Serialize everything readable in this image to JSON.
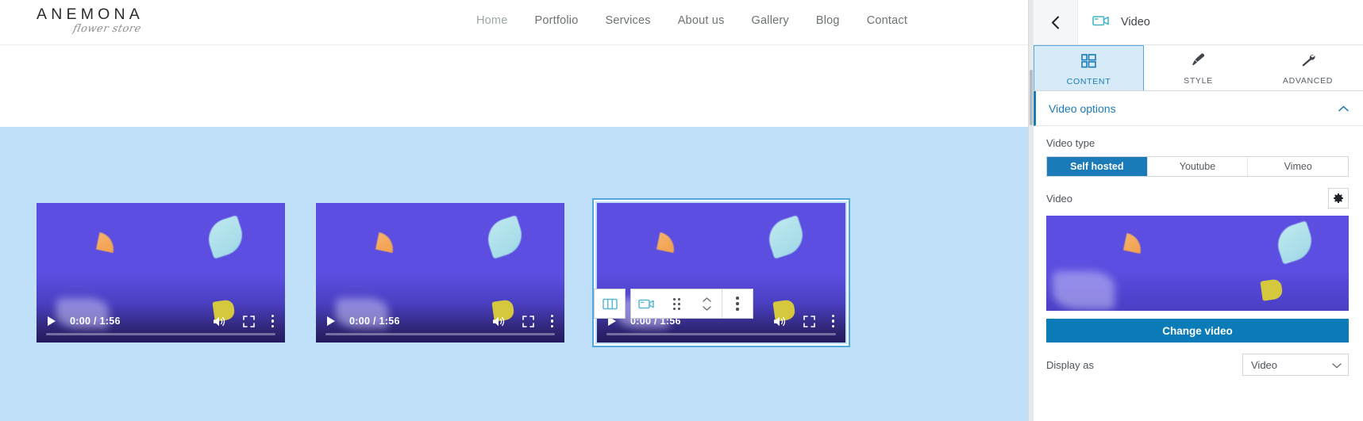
{
  "site": {
    "logo_main": "ANEMONA",
    "logo_sub": "flower store",
    "nav": [
      {
        "label": "Home",
        "active": true
      },
      {
        "label": "Portfolio",
        "active": false
      },
      {
        "label": "Services",
        "active": false
      },
      {
        "label": "About us",
        "active": false
      },
      {
        "label": "Gallery",
        "active": false
      },
      {
        "label": "Blog",
        "active": false
      },
      {
        "label": "Contact",
        "active": false
      }
    ]
  },
  "canvas": {
    "band_color": "#bfe0f8",
    "videos": [
      {
        "name": "video-1",
        "time": "0:00 / 1:56",
        "selected": false
      },
      {
        "name": "video-2",
        "time": "0:00 / 1:56",
        "selected": false
      },
      {
        "name": "video-3",
        "time": "0:00 / 1:56",
        "selected": true
      }
    ]
  },
  "toolbar": {
    "columns_icon": "columns-icon",
    "widget_icon": "video-widget-icon",
    "drag_icon": "drag-handle-icon",
    "reorder_icon": "reorder-arrows-icon",
    "more_icon": "more-options-icon"
  },
  "panel": {
    "back_icon": "chevron-left-icon",
    "header_icon": "video-icon",
    "title": "Video",
    "tabs": [
      {
        "label": "CONTENT",
        "icon": "layout-icon",
        "active": true
      },
      {
        "label": "STYLE",
        "icon": "brush-icon",
        "active": false
      },
      {
        "label": "ADVANCED",
        "icon": "wrench-icon",
        "active": false
      }
    ],
    "section": {
      "title": "Video options",
      "collapse_icon": "chevron-up-icon",
      "expanded": true
    },
    "video_type": {
      "label": "Video type",
      "options": [
        "Self hosted",
        "Youtube",
        "Vimeo"
      ],
      "selected": "Self hosted"
    },
    "video_field": {
      "label": "Video",
      "settings_icon": "gear-icon"
    },
    "change_video_label": "Change video",
    "display_as": {
      "label": "Display as",
      "value": "Video",
      "chevron_icon": "chevron-down-icon"
    }
  },
  "colors": {
    "accent_blue": "#1b7bb8",
    "button_blue": "#0c7cb8",
    "band_blue": "#bfe0f8",
    "video_purple": "#5b4ee0",
    "tab_active_bg": "#d6eaf7"
  }
}
